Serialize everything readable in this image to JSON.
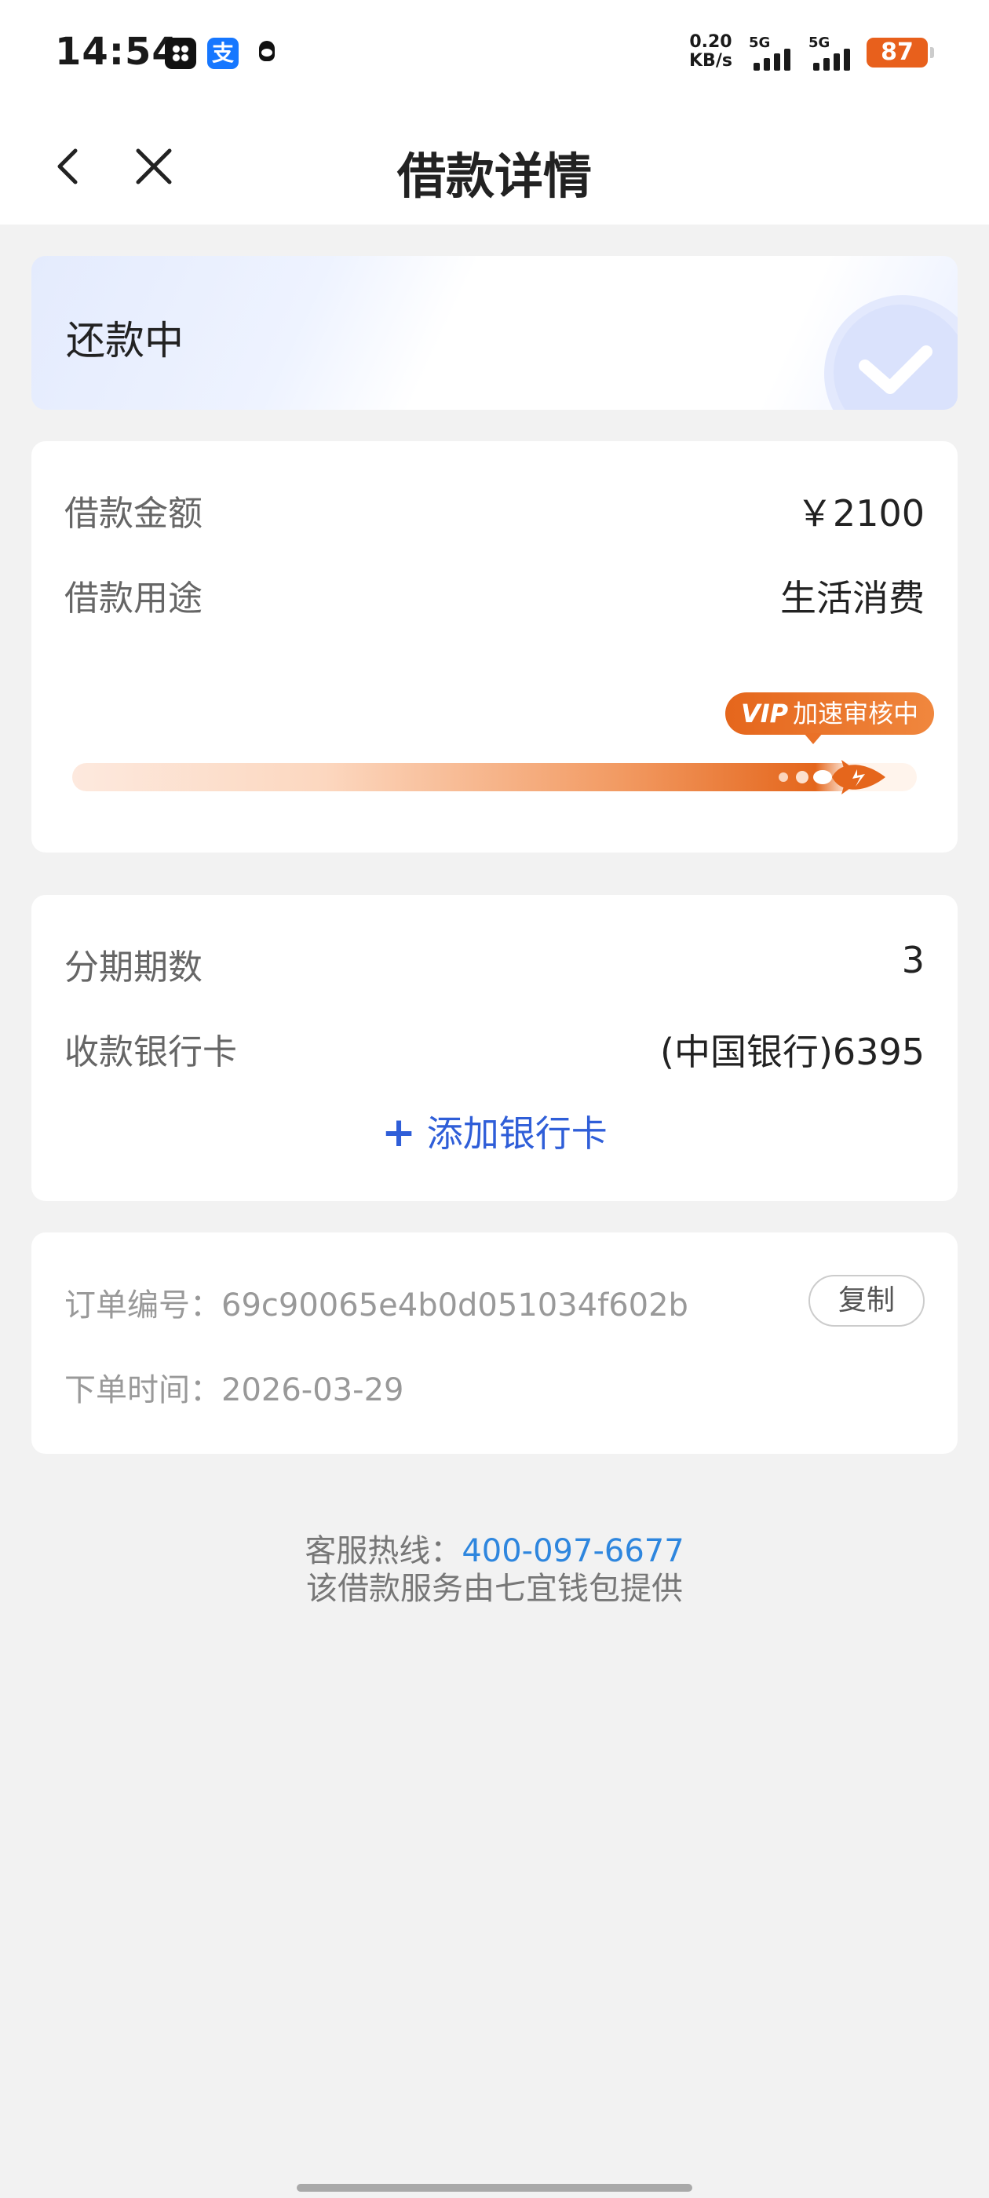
{
  "status_bar": {
    "time": "14:54",
    "alipay_glyph": "支",
    "net_speed_value": "0.20",
    "net_speed_unit": "KB/s",
    "signal1_label": "5G",
    "signal2_label": "5G",
    "battery": "87",
    "app_icons": [
      "pinduoduo-like-icon",
      "alipay-icon",
      "qq-icon"
    ]
  },
  "nav": {
    "title": "借款详情",
    "back_icon": "chevron-left-icon",
    "close_icon": "close-icon"
  },
  "status_card": {
    "status": "还款中",
    "icon": "check-icon"
  },
  "loan": {
    "amount_label": "借款金额",
    "amount_value": "￥2100",
    "purpose_label": "借款用途",
    "purpose_value": "生活消费",
    "vip_mark": "VIP",
    "vip_text": "加速审核中"
  },
  "bank": {
    "installments_label": "分期期数",
    "installments_value": "3",
    "card_label": "收款银行卡",
    "card_value": "(中国银行)6395",
    "add_card_plus": "+",
    "add_card_label": "添加银行卡"
  },
  "order": {
    "number_label": "订单编号：",
    "number_value": "69c90065e4b0d051034f602b",
    "copy_label": "复制",
    "time_label": "下单时间：",
    "time_value": "2026-03-29"
  },
  "footer": {
    "hotline_label": "客服热线：",
    "hotline_number": "400-097-6677",
    "provider_text": "该借款服务由七宜钱包提供"
  },
  "colors": {
    "accent_orange": "#e5661c",
    "link_blue": "#2f5ed8",
    "hotline_blue": "#2e86de"
  }
}
